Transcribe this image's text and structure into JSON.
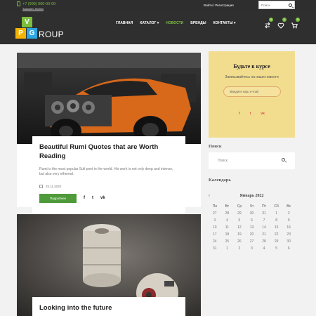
{
  "topbar": {
    "phone": "+7 (999) 000-00-00",
    "callback": "Заказать звонок",
    "login": "Войти / Регистрация",
    "search_placeholder": "Поиск"
  },
  "logo": {
    "v": "V",
    "p": "P",
    "g": "G",
    "rest": "ROUP"
  },
  "nav": [
    {
      "label": "ГЛАВНАЯ"
    },
    {
      "label": "КАТАЛОГ ▾"
    },
    {
      "label": "НОВОСТИ"
    },
    {
      "label": "БРЕНДЫ"
    },
    {
      "label": "КОНТАКТЫ ▾"
    }
  ],
  "header_icons": [
    {
      "icon": "compare-icon",
      "count": "0"
    },
    {
      "icon": "heart-icon",
      "count": "0"
    },
    {
      "icon": "cart-icon",
      "count": "0"
    }
  ],
  "posts": [
    {
      "title": "Beautiful Rumi Quotes that are Worth Reading",
      "excerpt": "Rumi is the most popular Sufi poet in the world. His work is not only deep and intense, but also very ethereal.",
      "date": "25.11.2020",
      "more": "Подробнее",
      "socials": [
        "f",
        "t",
        "vk"
      ]
    },
    {
      "title": "Looking into the future"
    }
  ],
  "subscribe": {
    "title": "Будьте в курсе",
    "text": "Записывайтесь на наши новости",
    "email_placeholder": "Введите ваш e-mail",
    "socials": [
      "f",
      "t",
      "vk"
    ]
  },
  "search_widget": {
    "title": "Поиск",
    "placeholder": "Поиск"
  },
  "calendar": {
    "title": "Календарь",
    "prev": "‹",
    "month": "Январь 2022",
    "weekdays": [
      "Пн",
      "Вт",
      "Ср",
      "Чт",
      "Пт",
      "Сб",
      "Вс"
    ],
    "weeks": [
      [
        "27",
        "28",
        "29",
        "30",
        "31",
        "1",
        "2"
      ],
      [
        "3",
        "4",
        "5",
        "6",
        "7",
        "8",
        "9"
      ],
      [
        "10",
        "11",
        "12",
        "13",
        "14",
        "15",
        "16"
      ],
      [
        "17",
        "18",
        "19",
        "20",
        "21",
        "22",
        "23"
      ],
      [
        "24",
        "25",
        "26",
        "27",
        "28",
        "29",
        "30"
      ],
      [
        "31",
        "1",
        "2",
        "3",
        "4",
        "5",
        "6"
      ]
    ]
  },
  "colors": {
    "accent": "#7cbf3f",
    "dark": "#2f2f2f",
    "subscribe_bg": "#f2dd8e",
    "button": "#4f9a3a"
  }
}
